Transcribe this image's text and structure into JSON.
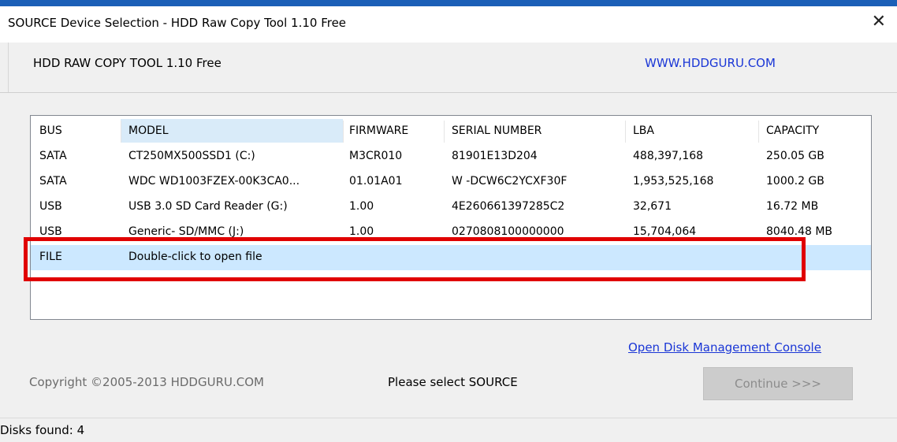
{
  "window": {
    "title": "SOURCE Device Selection - HDD Raw Copy Tool 1.10   Free",
    "close_glyph": "✕"
  },
  "header": {
    "app_name": "HDD RAW COPY TOOL 1.10   Free",
    "site_link": "WWW.HDDGURU.COM"
  },
  "table": {
    "columns": [
      "BUS",
      "MODEL",
      "FIRMWARE",
      "SERIAL NUMBER",
      "LBA",
      "CAPACITY"
    ],
    "rows": [
      [
        "SATA",
        "CT250MX500SSD1 (C:)",
        "M3CR010",
        "81901E13D204",
        "488,397,168",
        "250.05 GB"
      ],
      [
        "SATA",
        "WDC WD1003FZEX-00K3CA0...",
        "01.01A01",
        "W -DCW6C2YCXF30F",
        "1,953,525,168",
        "1000.2 GB"
      ],
      [
        "USB",
        "USB 3.0 SD Card Reader (G:)",
        "1.00",
        "4E260661397285C2",
        "32,671",
        "16.72 MB"
      ],
      [
        "USB",
        "Generic- SD/MMC (J:)",
        "1.00",
        "0270808100000000",
        "15,704,064",
        "8040.48 MB"
      ],
      [
        "FILE",
        "Double-click to open file",
        "",
        "",
        "",
        ""
      ]
    ],
    "selected_row": 4
  },
  "footer": {
    "disk_mgmt_link": "Open Disk Management Console",
    "copyright": "Copyright ©2005-2013 HDDGURU.COM",
    "status_message": "Please select SOURCE",
    "continue_label": "Continue >>>"
  },
  "statusbar": {
    "disks_found": "Disks found: 4"
  },
  "colors": {
    "link": "#1a36d6",
    "selection": "#cce8ff",
    "highlight": "#e00000",
    "title_strip": "#1b5fb7"
  }
}
